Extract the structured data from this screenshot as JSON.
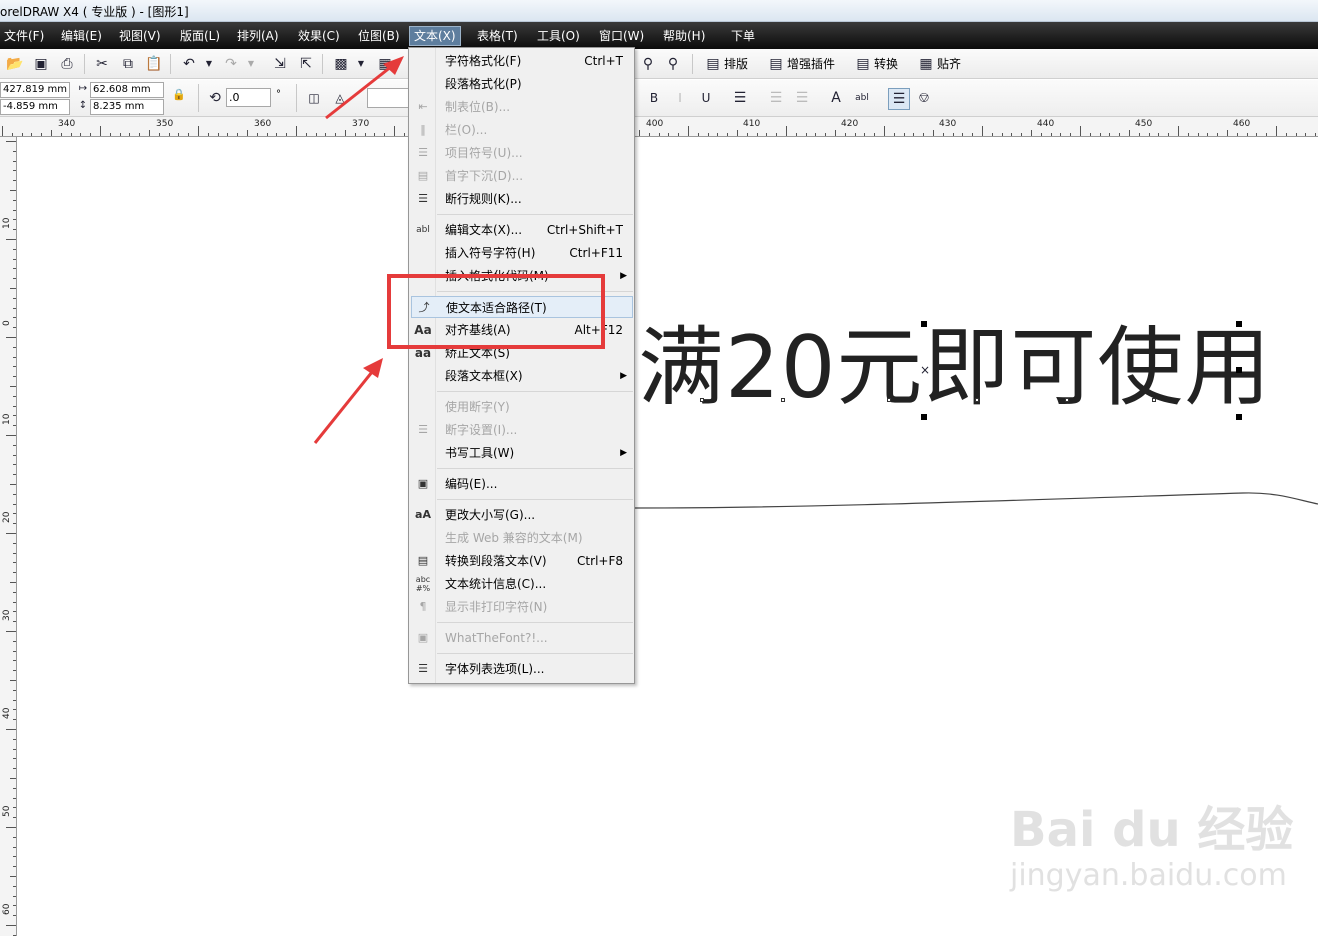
{
  "window": {
    "title": "orelDRAW X4 ( 专业版 ) - [图形1]"
  },
  "menubar": {
    "items": [
      {
        "label": "文件(F)"
      },
      {
        "label": "编辑(E)"
      },
      {
        "label": "视图(V)"
      },
      {
        "label": "版面(L)"
      },
      {
        "label": "排列(A)"
      },
      {
        "label": "效果(C)"
      },
      {
        "label": "位图(B)"
      },
      {
        "label": "文本(X)"
      },
      {
        "label": "表格(T)"
      },
      {
        "label": "工具(O)"
      },
      {
        "label": "窗口(W)"
      },
      {
        "label": "帮助(H)"
      },
      {
        "label": "下单"
      }
    ]
  },
  "toolbar": {
    "plugins": {
      "layout": "排版",
      "enhance": "增强插件",
      "convert": "转换",
      "align": "贴齐"
    }
  },
  "property_bar": {
    "x": "427.819 mm",
    "y": "-4.859 mm",
    "width": "62.608 mm",
    "height": "8.235 mm",
    "rotation": ".0",
    "degree": "°"
  },
  "ruler": {
    "h_labels": [
      "340",
      "350",
      "360",
      "370",
      "400",
      "410",
      "420",
      "430",
      "440",
      "450",
      "460"
    ],
    "v_labels": [
      "10",
      "0",
      "10",
      "20",
      "30",
      "40",
      "50",
      "60"
    ]
  },
  "canvas": {
    "text": "满20元即可使用"
  },
  "dropdown": {
    "items": [
      {
        "label": "字符格式化(F)",
        "shortcut": "Ctrl+T",
        "icon": "char-format-icon"
      },
      {
        "label": "段落格式化(P)",
        "shortcut": "",
        "icon": "para-format-icon"
      },
      {
        "label": "制表位(B)...",
        "shortcut": "",
        "icon": "tab-icon"
      },
      {
        "label": "栏(O)...",
        "shortcut": "",
        "icon": "columns-icon"
      },
      {
        "label": "项目符号(U)...",
        "shortcut": "",
        "icon": "bullets-icon"
      },
      {
        "label": "首字下沉(D)...",
        "shortcut": "",
        "icon": "dropcap-icon"
      },
      {
        "label": "断行规则(K)...",
        "shortcut": "",
        "icon": "linebreak-icon"
      },
      {
        "label": "编辑文本(X)...",
        "shortcut": "Ctrl+Shift+T",
        "icon": "edit-text-icon"
      },
      {
        "label": "插入符号字符(H)",
        "shortcut": "Ctrl+F11",
        "icon": "symbol-icon"
      },
      {
        "label": "插入格式化代码(M)",
        "shortcut": "",
        "icon": "format-code-icon"
      },
      {
        "label": "使文本适合路径(T)",
        "shortcut": "",
        "icon": "fit-path-icon"
      },
      {
        "label": "对齐基线(A)",
        "shortcut": "Alt+F12",
        "icon": "baseline-icon"
      },
      {
        "label": "矫正文本(S)",
        "shortcut": "",
        "icon": "straighten-icon"
      },
      {
        "label": "段落文本框(X)",
        "shortcut": "",
        "icon": "para-frame-icon"
      },
      {
        "label": "使用断字(Y)",
        "shortcut": "",
        "icon": "hyphen-icon"
      },
      {
        "label": "断字设置(I)...",
        "shortcut": "",
        "icon": "hyphen-settings-icon"
      },
      {
        "label": "书写工具(W)",
        "shortcut": "",
        "icon": "writing-tools-icon"
      },
      {
        "label": "编码(E)...",
        "shortcut": "",
        "icon": "encoding-icon"
      },
      {
        "label": "更改大小写(G)...",
        "shortcut": "",
        "icon": "change-case-icon"
      },
      {
        "label": "生成 Web 兼容的文本(M)",
        "shortcut": "",
        "icon": "web-text-icon"
      },
      {
        "label": "转换到段落文本(V)",
        "shortcut": "Ctrl+F8",
        "icon": "convert-para-icon"
      },
      {
        "label": "文本统计信息(C)...",
        "shortcut": "",
        "icon": "stats-icon"
      },
      {
        "label": "显示非打印字符(N)",
        "shortcut": "",
        "icon": "pilcrow-icon"
      },
      {
        "label": "WhatTheFont?!...",
        "shortcut": "",
        "icon": "whatthefont-icon"
      },
      {
        "label": "字体列表选项(L)...",
        "shortcut": "",
        "icon": "font-list-icon"
      }
    ]
  },
  "watermark": {
    "brand": "Bai du 经验",
    "url": "jingyan.baidu.com"
  },
  "annotation": {
    "color": "#e53b3b"
  }
}
